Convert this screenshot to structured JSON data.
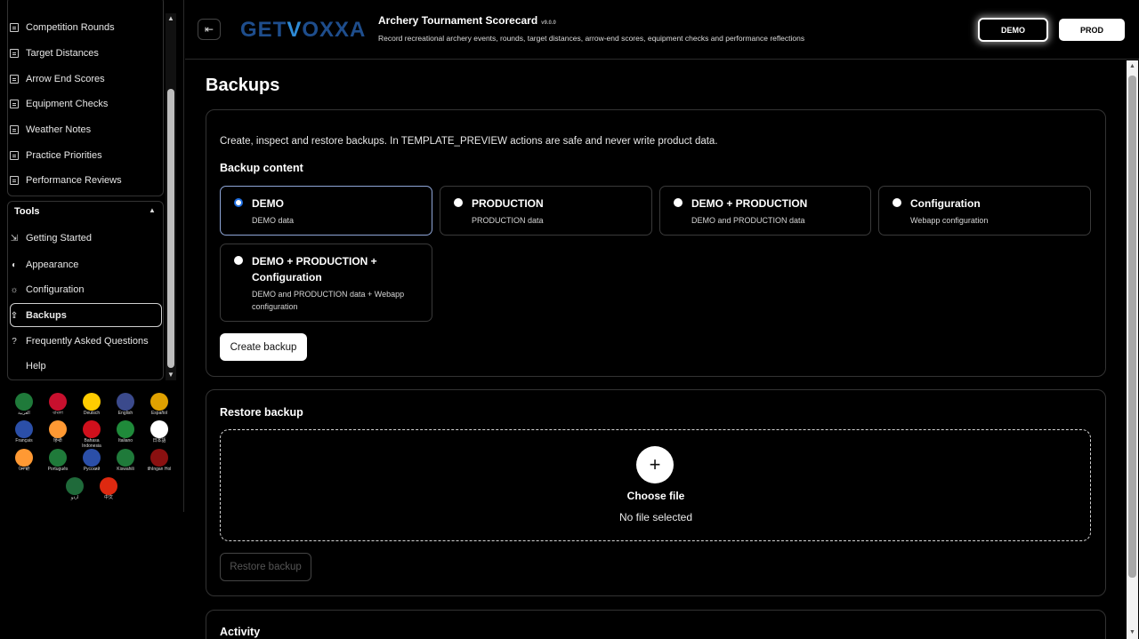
{
  "sidebar": {
    "nav_items": [
      {
        "label": "Competition Rounds",
        "icon": "document-icon"
      },
      {
        "label": "Target Distances",
        "icon": "document-icon"
      },
      {
        "label": "Arrow End Scores",
        "icon": "document-icon"
      },
      {
        "label": "Equipment Checks",
        "icon": "document-icon"
      },
      {
        "label": "Weather Notes",
        "icon": "document-icon"
      },
      {
        "label": "Practice Priorities",
        "icon": "document-icon"
      },
      {
        "label": "Performance Reviews",
        "icon": "document-icon"
      }
    ],
    "tools_heading": "Tools",
    "tools_items": [
      {
        "label": "Getting Started",
        "icon": "start-icon"
      },
      {
        "label": "Appearance",
        "icon": "palette-icon"
      },
      {
        "label": "Configuration",
        "icon": "gear-icon"
      },
      {
        "label": "Backups",
        "icon": "upload-icon",
        "active": true
      },
      {
        "label": "Frequently Asked Questions",
        "icon": "question-icon"
      },
      {
        "label": "Help",
        "icon": ""
      }
    ],
    "languages": [
      {
        "label": "العربية",
        "color": "#1f7a3a"
      },
      {
        "label": "বাংলা",
        "color": "#c8102e"
      },
      {
        "label": "Deutsch",
        "color": "#ffcc00"
      },
      {
        "label": "English",
        "color": "#3b4a8c"
      },
      {
        "label": "Español",
        "color": "#e0a100"
      },
      {
        "label": "Français",
        "color": "#2b4fa8"
      },
      {
        "label": "हिन्दी",
        "color": "#ff9933"
      },
      {
        "label": "Bahasa Indonesia",
        "color": "#d0101c"
      },
      {
        "label": "Italiano",
        "color": "#1f8a3a"
      },
      {
        "label": "日本語",
        "color": "#ffffff"
      },
      {
        "label": "ਪੰਜਾਬੀ",
        "color": "#ff9933"
      },
      {
        "label": "Português",
        "color": "#1f7a3a"
      },
      {
        "label": "Русский",
        "color": "#2b4fa8"
      },
      {
        "label": "Kiswahili",
        "color": "#1f7a3a"
      },
      {
        "label": "tlhIngan Hol",
        "color": "#8a1010"
      },
      {
        "label": "اردو",
        "color": "#1f6a3a"
      },
      {
        "label": "中文",
        "color": "#de2910"
      }
    ]
  },
  "header": {
    "logo_text_a": "GET",
    "logo_text_v": "V",
    "logo_text_b": "OXXA",
    "app_title": "Archery Tournament Scorecard",
    "version": "v9.0.0",
    "subtitle": "Record recreational archery events, rounds, target distances, arrow-end scores, equipment checks and performance reflections",
    "env_demo": "DEMO",
    "env_prod": "PROD"
  },
  "main": {
    "page_title": "Backups",
    "intro": "Create, inspect and restore backups. In TEMPLATE_PREVIEW actions are safe and never write product data.",
    "backup_content_heading": "Backup content",
    "options": [
      {
        "label": "DEMO",
        "desc": "DEMO data",
        "selected": true
      },
      {
        "label": "PRODUCTION",
        "desc": "PRODUCTION data",
        "selected": false
      },
      {
        "label": "DEMO + PRODUCTION",
        "desc": "DEMO and PRODUCTION data",
        "selected": false
      },
      {
        "label": "Configuration",
        "desc": "Webapp configuration",
        "selected": false
      },
      {
        "label": "DEMO + PRODUCTION + Configuration",
        "desc": "DEMO and PRODUCTION data + Webapp configuration",
        "selected": false
      }
    ],
    "create_button": "Create backup",
    "restore_heading": "Restore backup",
    "choose_file": "Choose file",
    "no_file": "No file selected",
    "restore_button": "Restore backup",
    "activity_heading": "Activity"
  }
}
